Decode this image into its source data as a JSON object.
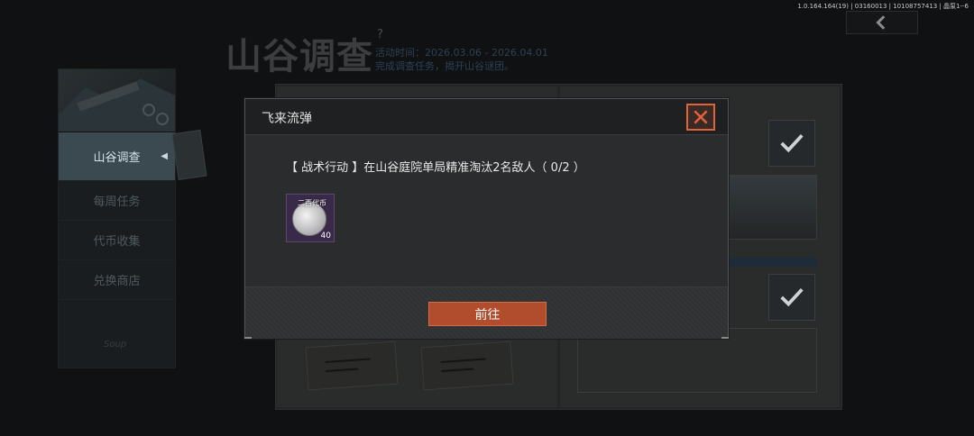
{
  "version_text": "1.0.164.164(19) | 03160013 | 10108757413 | 晶泵1--6",
  "event": {
    "title": "山谷调查",
    "help": "?",
    "time": "活动时间：2026.03.06 - 2026.04.01",
    "desc": "完成调查任务，揭开山谷谜团。"
  },
  "sidebar": {
    "items": [
      {
        "label": "山谷调查"
      },
      {
        "label": "每周任务"
      },
      {
        "label": "代币收集"
      },
      {
        "label": "兑换商店"
      }
    ],
    "logo": "Soup"
  },
  "dialog": {
    "title": "飞来流弹",
    "mission": "【 战术行动 】在山谷庭院单局精准淘汰2名敌人（ 0/2 ）",
    "reward": {
      "name": "二西代币",
      "qty": "40"
    },
    "go_label": "前往"
  },
  "colors": {
    "accent": "#b14c2c",
    "close_border": "#e0633a"
  },
  "icons": {
    "back": "chevron-left-icon",
    "close": "close-icon",
    "check": "check-icon"
  }
}
